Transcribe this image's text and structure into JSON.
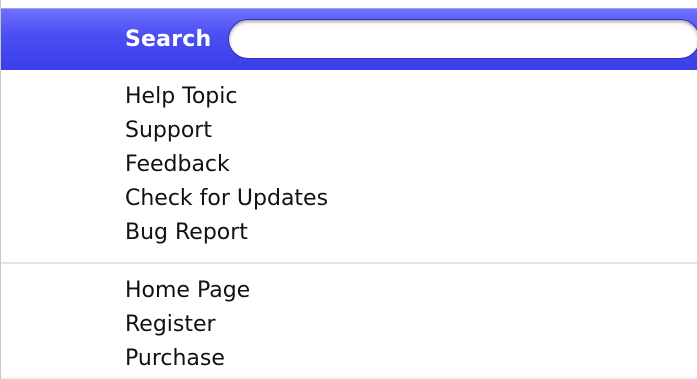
{
  "search": {
    "label": "Search",
    "value": "",
    "placeholder": ""
  },
  "menu": {
    "group1": [
      {
        "label": "Help Topic"
      },
      {
        "label": "Support"
      },
      {
        "label": "Feedback"
      },
      {
        "label": "Check for Updates"
      },
      {
        "label": "Bug Report"
      }
    ],
    "group2": [
      {
        "label": "Home Page"
      },
      {
        "label": "Register"
      },
      {
        "label": "Purchase"
      }
    ]
  },
  "colors": {
    "search_bar": "#4a4ef2",
    "menu_background": "#ffffff",
    "text": "#111111"
  }
}
